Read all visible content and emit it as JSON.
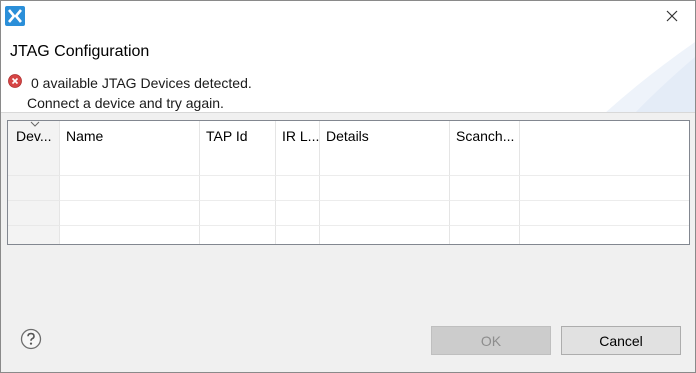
{
  "window": {
    "icon": "app-x-icon",
    "close_icon": "close-icon"
  },
  "header": {
    "title": "JTAG Configuration",
    "error_icon": "error-icon",
    "message_line1": "0 available JTAG Devices detected.",
    "message_line2": "Connect a device and try again."
  },
  "table": {
    "columns": [
      "Dev...",
      "Name",
      "TAP Id",
      "IR L...",
      "Details",
      "Scanch..."
    ],
    "sorted_column": "Dev...",
    "rows": [
      [
        "",
        "",
        "",
        "",
        "",
        "",
        ""
      ],
      [
        "",
        "",
        "",
        "",
        "",
        "",
        ""
      ],
      [
        "",
        "",
        "",
        "",
        "",
        "",
        ""
      ],
      [
        "",
        "",
        "",
        "",
        "",
        "",
        ""
      ]
    ]
  },
  "footer": {
    "help_icon": "help-icon",
    "ok_label": "OK",
    "cancel_label": "Cancel",
    "ok_enabled": false
  },
  "colors": {
    "app_icon_blue": "#2b8fd9",
    "error_red": "#d64545",
    "disabled_text": "#8d8d8d"
  }
}
